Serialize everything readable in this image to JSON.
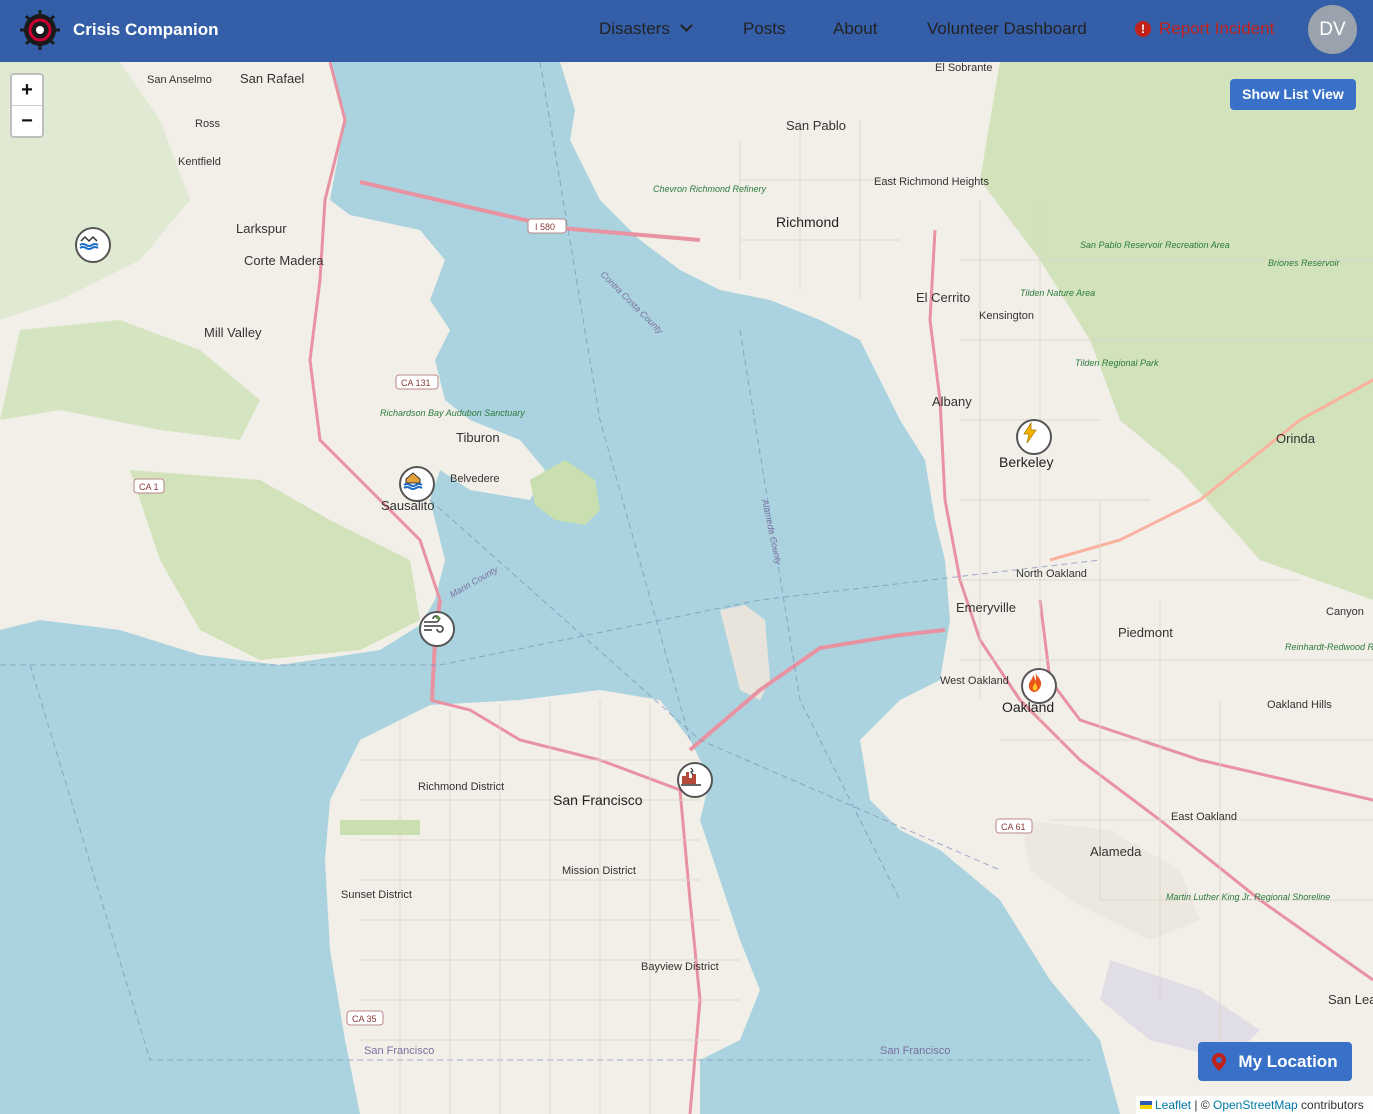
{
  "navbar": {
    "brand_name": "Crisis Companion",
    "disasters_label": "Disasters",
    "posts_label": "Posts",
    "about_label": "About",
    "volunteer_dashboard_label": "Volunteer Dashboard",
    "report_incident_label": "Report Incident",
    "avatar_initials": "DV"
  },
  "map_controls": {
    "zoom_in": "+",
    "zoom_out": "−",
    "show_list_view": "Show List View",
    "my_location": "My Location"
  },
  "attribution": {
    "leaflet": "Leaflet",
    "separator": " | © ",
    "osm": "OpenStreetMap",
    "contributors": " contributors"
  },
  "map_labels": {
    "places": {
      "san_anselmo": "San Anselmo",
      "san_rafael": "San Rafael",
      "ross": "Ross",
      "kentfield": "Kentfield",
      "larkspur": "Larkspur",
      "corte_madera": "Corte Madera",
      "mill_valley": "Mill Valley",
      "tiburon": "Tiburon",
      "belvedere": "Belvedere",
      "sausalito": "Sausalito",
      "san_pablo": "San Pablo",
      "richmond": "Richmond",
      "east_richmond_heights": "East Richmond Heights",
      "el_sobrante": "El Sobrante",
      "el_cerrito": "El Cerrito",
      "kensington": "Kensington",
      "albany": "Albany",
      "berkeley": "Berkeley",
      "orinda": "Orinda",
      "north_oakland": "North Oakland",
      "emeryville": "Emeryville",
      "piedmont": "Piedmont",
      "canyon": "Canyon",
      "west_oakland": "West Oakland",
      "oakland": "Oakland",
      "oakland_hills": "Oakland Hills",
      "east_oakland": "East Oakland",
      "alameda": "Alameda",
      "san_francisco": "San Francisco",
      "richmond_district": "Richmond District",
      "sunset_district": "Sunset District",
      "mission_district": "Mission District",
      "bayview_district": "Bayview District",
      "san_leandro": "San Lea",
      "san_francisco_county_bottom": "San Francisco",
      "san_francisco_county_left": "San Francisco"
    },
    "parks": {
      "chevron": "Chevron Richmond Refinery",
      "richardson_bay": "Richardson Bay Audubon Sanctuary",
      "san_pablo_reservoir": "San Pablo Reservoir Recreation Area",
      "briones": "Briones Reservoir",
      "tilden_nature": "Tilden Nature Area",
      "tilden_regional": "Tilden Regional Park",
      "reinhardt": "Reinhardt-Redwood Regional Park",
      "mlk_shoreline": "Martin Luther King Jr. Regional Shoreline",
      "contra_costa": "Contra Costa County",
      "alameda_county": "Alameda County",
      "marin_county": "Marin County"
    },
    "shields": {
      "i580": "I 580",
      "ca131": "CA 131",
      "ca1": "CA 1",
      "ca35": "CA 35",
      "ca61": "CA 61"
    }
  },
  "markers": [
    {
      "type": "flood-icon",
      "label": "Flood"
    },
    {
      "type": "house-flood-icon",
      "label": "House Flood"
    },
    {
      "type": "wind-icon",
      "label": "Wind"
    },
    {
      "type": "lightning-icon",
      "label": "Lightning"
    },
    {
      "type": "fire-icon",
      "label": "Fire"
    },
    {
      "type": "earthquake-icon",
      "label": "Earthquake"
    }
  ],
  "colors": {
    "navbar": "#345fa8",
    "button": "#3871c7",
    "report": "#c0221b",
    "water": "#aad3df",
    "land": "#f2efe9"
  }
}
